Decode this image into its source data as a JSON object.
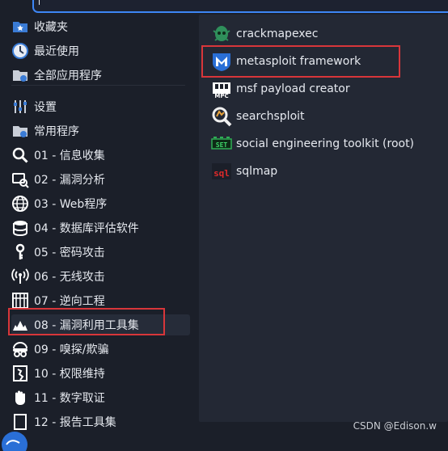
{
  "left_menu": [
    {
      "label": "收藏夹",
      "icon": "folder-star-icon",
      "selected": false
    },
    {
      "label": "最近使用",
      "icon": "clock-icon",
      "selected": false
    },
    {
      "label": "全部应用程序",
      "icon": "folder-apps-icon",
      "selected": false
    },
    {
      "label": "设置",
      "icon": "settings-icon",
      "selected": false
    },
    {
      "label": "常用程序",
      "icon": "folder-common-icon",
      "selected": false
    },
    {
      "label": "01 - 信息收集",
      "icon": "magnifier-icon",
      "selected": false
    },
    {
      "label": "02 - 漏洞分析",
      "icon": "vuln-analysis-icon",
      "selected": false
    },
    {
      "label": "03 - Web程序",
      "icon": "globe-icon",
      "selected": false
    },
    {
      "label": "04 - 数据库评估软件",
      "icon": "database-icon",
      "selected": false
    },
    {
      "label": "05 - 密码攻击",
      "icon": "key-icon",
      "selected": false
    },
    {
      "label": "06 - 无线攻击",
      "icon": "wireless-icon",
      "selected": false
    },
    {
      "label": "07 - 逆向工程",
      "icon": "reverse-icon",
      "selected": false
    },
    {
      "label": "08 - 漏洞利用工具集",
      "icon": "exploit-icon",
      "selected": true
    },
    {
      "label": "09 - 嗅探/欺骗",
      "icon": "sniff-icon",
      "selected": false
    },
    {
      "label": "10 - 权限维持",
      "icon": "persistence-icon",
      "selected": false
    },
    {
      "label": "11 - 数字取证",
      "icon": "hand-icon",
      "selected": false
    },
    {
      "label": "12 - 报告工具集",
      "icon": "report-icon",
      "selected": false
    }
  ],
  "apps": [
    {
      "label": "crackmapexec",
      "icon": "crackmapexec-icon"
    },
    {
      "label": "metasploit framework",
      "icon": "metasploit-icon"
    },
    {
      "label": "msf payload creator",
      "icon": "msfpc-icon"
    },
    {
      "label": "searchsploit",
      "icon": "searchsploit-icon"
    },
    {
      "label": "social engineering toolkit (root)",
      "icon": "set-icon"
    },
    {
      "label": "sqlmap",
      "icon": "sqlmap-icon"
    }
  ],
  "watermark": "CSDN @Edison.w",
  "colors": {
    "highlight_box": "#d8363a",
    "search_border": "#3d86f5",
    "background": "#1b1f29",
    "panel": "#232834"
  }
}
